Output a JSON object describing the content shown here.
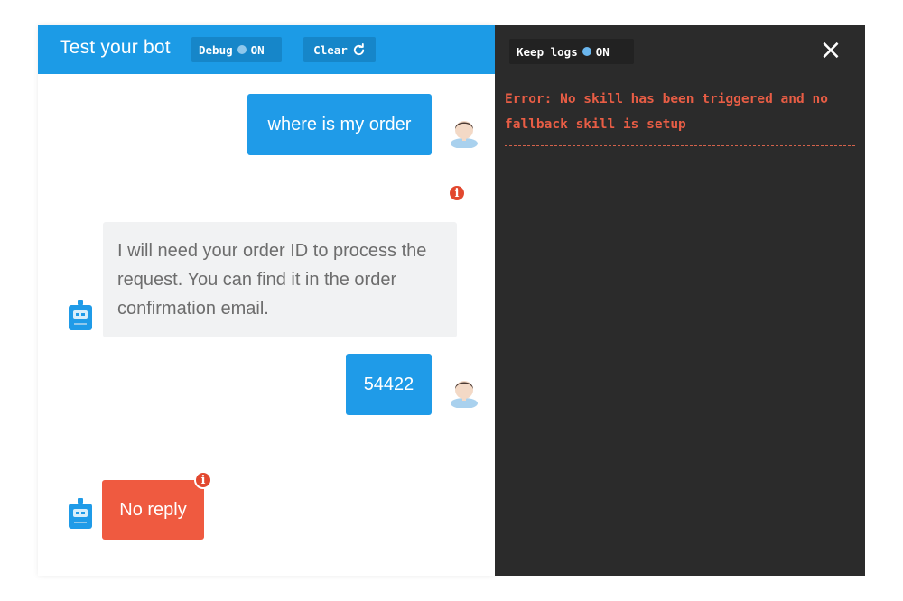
{
  "header": {
    "title": "Test your bot",
    "debug_label": "Debug",
    "debug_state": "ON",
    "clear_label": "Clear"
  },
  "messages": [
    {
      "sender": "user",
      "text": "where is my order"
    },
    {
      "sender": "bot",
      "text": "I will need your order ID to process the request. You can find it in the order confirmation email."
    },
    {
      "sender": "user",
      "text": "54422"
    },
    {
      "sender": "bot",
      "text": "No reply",
      "status": "error"
    }
  ],
  "log_panel": {
    "keep_logs_label": "Keep logs",
    "keep_logs_state": "ON",
    "close_icon": "×",
    "error_text": "Error: No skill has been triggered and no fallback skill is setup"
  },
  "info_icon_glyph": "i",
  "icons": [
    "refresh-icon",
    "user-avatar-icon",
    "bot-avatar-icon",
    "info-icon",
    "close-icon"
  ],
  "colors": {
    "header_blue": "#1c9be6",
    "user_bubble": "#1f9be8",
    "bot_bubble": "#f1f2f3",
    "error_bubble": "#ef5a40",
    "log_background": "#2b2b2b",
    "log_error_text": "#e85d45"
  }
}
